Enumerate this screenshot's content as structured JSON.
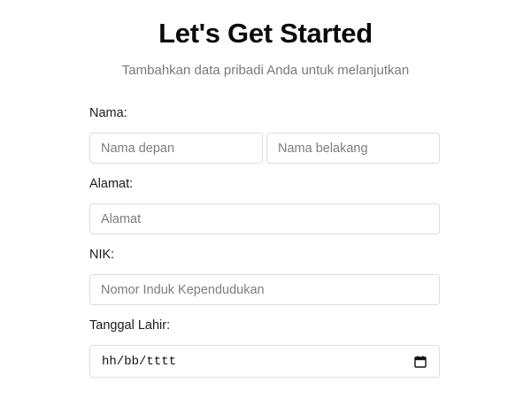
{
  "header": {
    "title": "Let's Get Started",
    "subtitle": "Tambahkan data pribadi Anda untuk melanjutkan"
  },
  "form": {
    "name": {
      "label": "Nama:",
      "first_placeholder": "Nama depan",
      "last_placeholder": "Nama belakang"
    },
    "address": {
      "label": "Alamat:",
      "placeholder": "Alamat"
    },
    "nik": {
      "label": "NIK:",
      "placeholder": "Nomor Induk Kependudukan"
    },
    "birthdate": {
      "label": "Tanggal Lahir:",
      "format_text": "hh/bb/tttt",
      "icon": "calendar-icon"
    }
  }
}
